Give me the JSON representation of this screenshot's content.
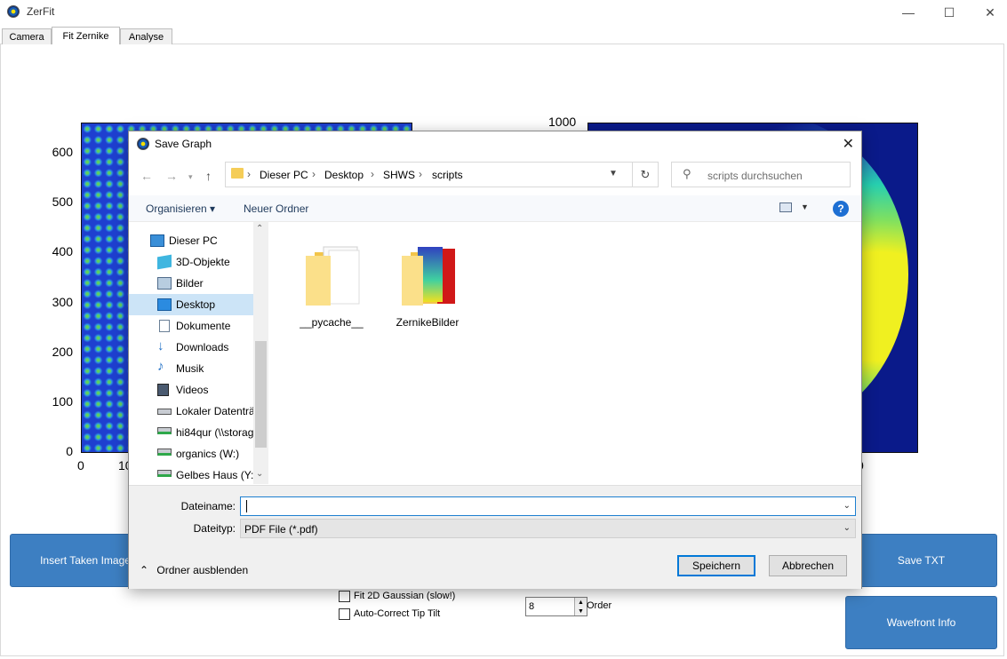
{
  "window": {
    "title": "ZerFit",
    "minimize": "—",
    "maximize": "☐",
    "close": "✕"
  },
  "tabs": [
    {
      "label": "Camera"
    },
    {
      "label": "Fit Zernike"
    },
    {
      "label": "Analyse"
    }
  ],
  "left_plot": {
    "yticks": [
      "600",
      "500",
      "400",
      "300",
      "200",
      "100",
      "0"
    ],
    "xticks": [
      "0",
      "10"
    ]
  },
  "right_plot": {
    "top_label": "1000",
    "x_partial": "0"
  },
  "buttons": {
    "insert": "Insert Taken Image",
    "save_txt": "Save TXT",
    "wavefront": "Wavefront Info"
  },
  "options": {
    "gaussian": "Fit 2D Gaussian (slow!)",
    "tiptilt": "Auto-Correct Tip Tilt",
    "order_value": "8",
    "order_label": "Order"
  },
  "dialog": {
    "title": "Save Graph",
    "breadcrumb": [
      "Dieser PC",
      "Desktop",
      "SHWS",
      "scripts"
    ],
    "search_placeholder": "scripts durchsuchen",
    "organize": "Organisieren ▾",
    "new_folder": "Neuer Ordner",
    "help": "?",
    "nav_items": [
      {
        "label": "Dieser PC",
        "icon": "computer-icon"
      },
      {
        "label": "3D-Objekte",
        "icon": "cube-icon"
      },
      {
        "label": "Bilder",
        "icon": "pictures-icon"
      },
      {
        "label": "Desktop",
        "icon": "desktop-icon"
      },
      {
        "label": "Dokumente",
        "icon": "documents-icon"
      },
      {
        "label": "Downloads",
        "icon": "download-icon"
      },
      {
        "label": "Musik",
        "icon": "music-icon"
      },
      {
        "label": "Videos",
        "icon": "videos-icon"
      },
      {
        "label": "Lokaler Datenträ",
        "icon": "drive-icon"
      },
      {
        "label": "hi84qur (\\\\storag",
        "icon": "network-drive-icon"
      },
      {
        "label": "organics (W:)",
        "icon": "network-drive-icon"
      },
      {
        "label": "Gelbes Haus (Y:)",
        "icon": "network-drive-icon"
      }
    ],
    "files": [
      {
        "name": "__pycache__"
      },
      {
        "name": "ZernikeBilder"
      }
    ],
    "filename_label": "Dateiname:",
    "filename_value": "",
    "filetype_label": "Dateityp:",
    "filetype_value": "PDF File (*.pdf)",
    "hide_folders": "Ordner ausblenden",
    "save": "Speichern",
    "cancel": "Abbrechen"
  }
}
